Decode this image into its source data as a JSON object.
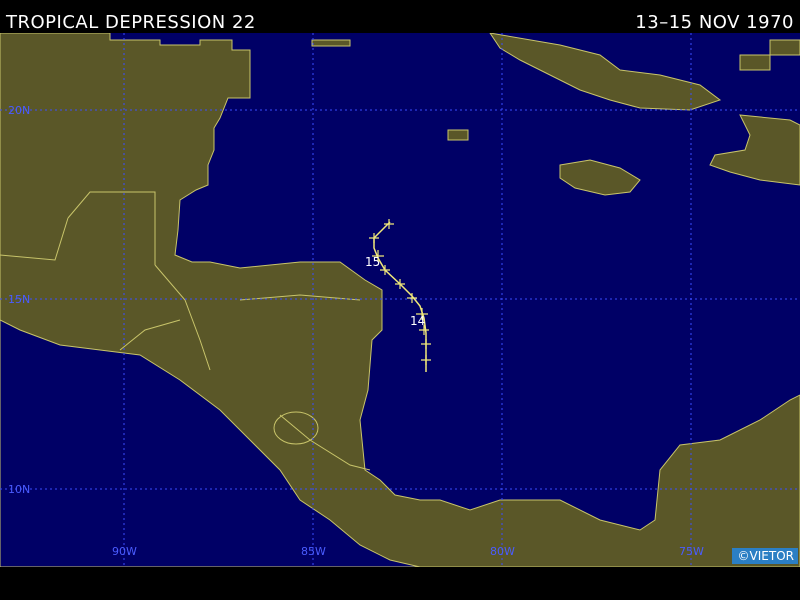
{
  "header": {
    "title": "TROPICAL DEPRESSION 22",
    "dates": "13–15 NOV 1970"
  },
  "grid": {
    "lat_labels": [
      "20N",
      "15N",
      "10N"
    ],
    "lon_labels": [
      "90W",
      "85W",
      "80W",
      "75W"
    ]
  },
  "track": {
    "day_labels": [
      "15",
      "14"
    ]
  },
  "credit": "©VIETOR",
  "colors": {
    "ocean": "#000066",
    "land": "#5a5728",
    "border": "#c8c46a",
    "grid": "#3a4cff",
    "track": "#f0e87a"
  }
}
